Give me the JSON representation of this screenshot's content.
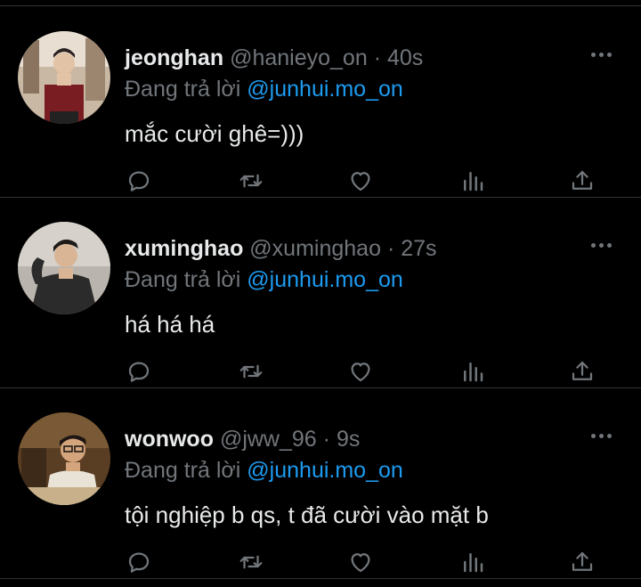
{
  "feed": {
    "tweets": [
      {
        "name": "jeonghan",
        "handle": "@hanieyo_on",
        "separator": "·",
        "time": "40s",
        "reply_prefix": "Đang trả lời",
        "reply_to": "@junhui.mo_on",
        "text": "mắc cười ghê=)))"
      },
      {
        "name": "xuminghao",
        "handle": "@xuminghao",
        "separator": "·",
        "time": "27s",
        "reply_prefix": "Đang trả lời",
        "reply_to": "@junhui.mo_on",
        "text": "há há há"
      },
      {
        "name": "wonwoo",
        "handle": "@jww_96",
        "separator": "·",
        "time": "9s",
        "reply_prefix": "Đang trả lời",
        "reply_to": "@junhui.mo_on",
        "text": "tội nghiệp b qs, t đã cười vào mặt b"
      }
    ],
    "icons": [
      "reply-icon",
      "retweet-icon",
      "like-icon",
      "stats-icon",
      "share-icon",
      "more-icon"
    ]
  },
  "colors": {
    "background": "#000000",
    "text": "#e7e9ea",
    "muted": "#71767b",
    "accent": "#1d9bf0",
    "divider": "#2f3336"
  }
}
